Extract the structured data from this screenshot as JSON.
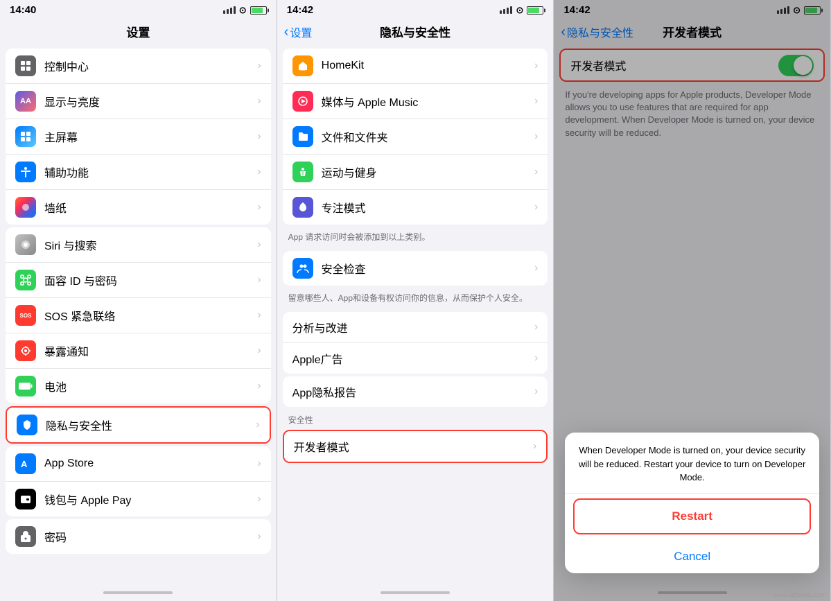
{
  "panel1": {
    "time": "14:40",
    "title": "设置",
    "items": [
      {
        "id": "control-center",
        "icon": "⊞",
        "iconClass": "ic-control",
        "label": "控制中心",
        "value": ""
      },
      {
        "id": "display",
        "icon": "AA",
        "iconClass": "ic-display",
        "label": "显示与亮度",
        "value": ""
      },
      {
        "id": "homescreen",
        "icon": "⊞",
        "iconClass": "ic-homescreen",
        "label": "主屏幕",
        "value": ""
      },
      {
        "id": "accessibility",
        "icon": "♿",
        "iconClass": "ic-accessibility",
        "label": "辅助功能",
        "value": ""
      },
      {
        "id": "wallpaper",
        "icon": "🌸",
        "iconClass": "ic-wallpaper",
        "label": "墙纸",
        "value": ""
      },
      {
        "id": "siri",
        "icon": "◉",
        "iconClass": "ic-siri",
        "label": "Siri 与搜索",
        "value": ""
      },
      {
        "id": "faceid",
        "icon": "👤",
        "iconClass": "ic-faceid",
        "label": "面容 ID 与密码",
        "value": ""
      },
      {
        "id": "sos",
        "icon": "SOS",
        "iconClass": "ic-sos",
        "label": "SOS 紧急联络",
        "value": ""
      },
      {
        "id": "exposure",
        "icon": "⊛",
        "iconClass": "ic-exposure",
        "label": "暴露通知",
        "value": ""
      },
      {
        "id": "battery",
        "icon": "▬",
        "iconClass": "ic-battery",
        "label": "电池",
        "value": ""
      },
      {
        "id": "privacy",
        "icon": "✋",
        "iconClass": "ic-privacy",
        "label": "隐私与安全性",
        "value": "",
        "highlight": true
      },
      {
        "id": "appstore",
        "icon": "A",
        "iconClass": "ic-appstore",
        "label": "App Store",
        "value": ""
      },
      {
        "id": "wallet",
        "icon": "▣",
        "iconClass": "ic-wallet",
        "label": "钱包与 Apple Pay",
        "value": ""
      },
      {
        "id": "passcode",
        "icon": "🔑",
        "iconClass": "ic-passcode",
        "label": "密码",
        "value": ""
      }
    ]
  },
  "panel2": {
    "time": "14:42",
    "back_label": "设置",
    "title": "隐私与安全性",
    "app_section_label": "App 请求访问时会被添加到以上类别。",
    "items_top": [
      {
        "id": "homekit",
        "icon": "🏠",
        "iconClass": "si-homekit",
        "label": "HomeKit"
      },
      {
        "id": "media",
        "icon": "🎵",
        "iconClass": "si-media",
        "label": "媒体与 Apple Music"
      },
      {
        "id": "files",
        "icon": "📁",
        "iconClass": "si-files",
        "label": "文件和文件夹"
      },
      {
        "id": "health",
        "icon": "🏃",
        "iconClass": "si-health",
        "label": "运动与健身"
      },
      {
        "id": "focus",
        "icon": "🌙",
        "iconClass": "si-focus",
        "label": "专注模式"
      }
    ],
    "safety_item": {
      "id": "safety",
      "icon": "👥",
      "iconClass": "si-safety",
      "label": "安全检查"
    },
    "safety_desc": "留意哪些人、App和设备有权访问你的信息，从而保护个人安全。",
    "items_bottom": [
      {
        "id": "analytics",
        "label": "分析与改进"
      },
      {
        "id": "appleads",
        "label": "Apple广告"
      }
    ],
    "privacy_report": {
      "label": "App隐私报告"
    },
    "security_section": "安全性",
    "developer_mode": {
      "id": "developer",
      "label": "开发者模式",
      "highlight": true
    }
  },
  "panel3": {
    "time": "14:42",
    "back_label": "隐私与安全性",
    "title": "开发者模式",
    "toggle_label": "开发者模式",
    "toggle_on": true,
    "description": "If you're developing apps for Apple products, Developer Mode allows you to use features that are required for app development. When Developer Mode is turned on, your device security will be reduced.",
    "dialog_message": "When Developer Mode is turned on, your device security will be reduced. Restart your device to turn on Developer Mode.",
    "restart_label": "Restart",
    "cancel_label": "Cancel"
  },
  "icons": {
    "arrow": "›",
    "back_arrow": "‹",
    "chevron": ">"
  }
}
